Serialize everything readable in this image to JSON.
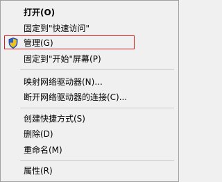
{
  "menu": {
    "items": [
      {
        "label": "打开(O)"
      },
      {
        "label": "固定到\"快速访问\""
      },
      {
        "label": "管理(G)"
      },
      {
        "label": "固定到\"开始\"屏幕(P)"
      },
      {
        "label": "映射网络驱动器(N)..."
      },
      {
        "label": "断开网络驱动器的连接(C)..."
      },
      {
        "label": "创建快捷方式(S)"
      },
      {
        "label": "删除(D)"
      },
      {
        "label": "重命名(M)"
      },
      {
        "label": "属性(R)"
      }
    ]
  },
  "colors": {
    "menu_bg": "#f0f0f0",
    "highlight_border": "#d62020",
    "separator": "#c8c8c8"
  },
  "icons": {
    "manage": "shield-icon"
  }
}
